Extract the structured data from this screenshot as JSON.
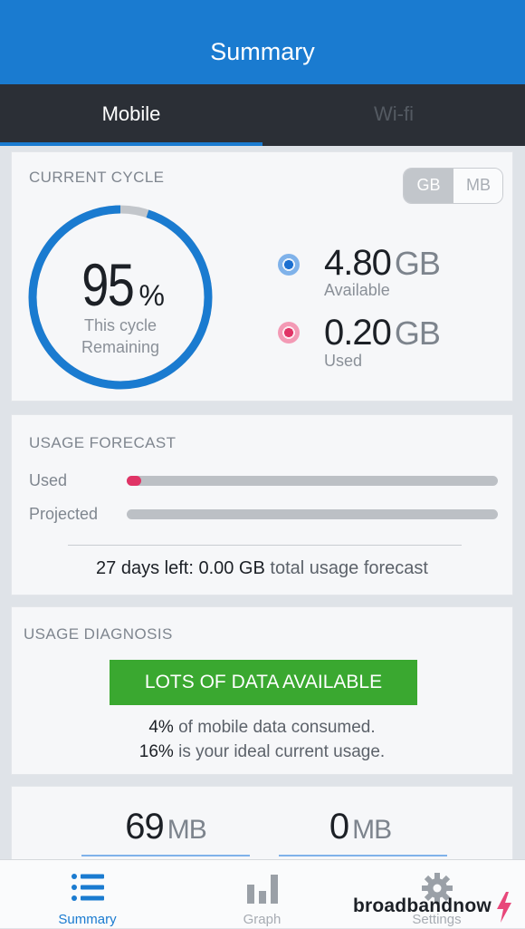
{
  "header": {
    "title": "Summary"
  },
  "tabs": [
    {
      "label": "Mobile",
      "active": true
    },
    {
      "label": "Wi-fi",
      "active": false
    }
  ],
  "current_cycle": {
    "label": "CURRENT CYCLE",
    "units": {
      "gb": "GB",
      "mb": "MB",
      "selected": "GB"
    },
    "percent_value": "95",
    "percent_sign": "%",
    "ring_remaining_fraction": 0.95,
    "ring_line1": "This cycle",
    "ring_line2": "Remaining",
    "available_value": "4.80",
    "available_unit": "GB",
    "available_label": "Available",
    "used_value": "0.20",
    "used_unit": "GB",
    "used_label": "Used",
    "colors": {
      "available": "#1a7bd0",
      "used": "#e03466",
      "ring_track": "#c2c6cb"
    }
  },
  "usage_forecast": {
    "label": "USAGE FORECAST",
    "used_label": "Used",
    "used_fraction": 0.04,
    "projected_label": "Projected",
    "projected_fraction": 0.0,
    "days_left": "27",
    "days_left_text": "days left:",
    "total_value": "0.00 GB",
    "total_text": "total usage forecast"
  },
  "usage_diagnosis": {
    "label": "USAGE DIAGNOSIS",
    "badge": "LOTS OF DATA AVAILABLE",
    "badge_color": "#3aa830",
    "consumed_value": "4%",
    "consumed_text": "of mobile data consumed.",
    "ideal_value": "16%",
    "ideal_text": "is your ideal current usage."
  },
  "bottom_stats": [
    {
      "value": "69",
      "unit": "MB"
    },
    {
      "value": "0",
      "unit": "MB"
    }
  ],
  "nav": [
    {
      "label": "Summary",
      "icon": "list-icon",
      "active": true
    },
    {
      "label": "Graph",
      "icon": "bar-chart-icon",
      "active": false
    },
    {
      "label": "Settings",
      "icon": "gear-icon",
      "active": false
    }
  ],
  "watermark": {
    "text": "broadbandnow"
  }
}
